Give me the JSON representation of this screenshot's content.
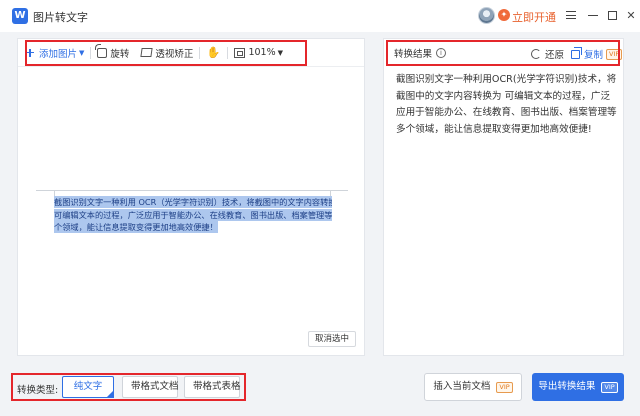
{
  "app": {
    "title": "图片转文字",
    "logo_letter": "W",
    "vip_link": "立即开通",
    "vip_icon_glyph": "✦"
  },
  "toolbar": {
    "add_image": "添加图片",
    "rotate": "旋转",
    "perspective": "透视矫正",
    "zoom": "101%"
  },
  "canvas": {
    "ocr_lines": [
      "截图识别文字一种利用 OCR（光学字符识别）技术，将截图中的文字内容转换为",
      "可编辑文本的过程，广泛应用于智能办公、在线教育、图书出版、档案管理等多",
      "个领域，能让信息提取变得更加地高效便捷！"
    ],
    "cancel_selection": "取消选中"
  },
  "result": {
    "title": "转换结果",
    "info_glyph": "i",
    "restore": "还原",
    "copy": "复制",
    "vip_tag": "VIP",
    "text": "截图识别文字一种利用OCR(光学字符识别)技术，将截图中的文字内容转换为 可编辑文本的过程，广泛应用于智能办公、在线教育、图书出版、档案管理等多个领域，能让信息提取变得更加地高效便捷!"
  },
  "bottom": {
    "type_label": "转换类型:",
    "types": [
      "纯文字",
      "带格式文档",
      "带格式表格"
    ],
    "selected_type": "纯文字",
    "insert_doc": "插入当前文档",
    "export": "导出转换结果",
    "vip_tag": "VIP"
  },
  "colors": {
    "accent": "#2f6fe4",
    "highlight": "#e4262b",
    "vip_orange": "#e8622f",
    "selection": "#adc7ee"
  }
}
